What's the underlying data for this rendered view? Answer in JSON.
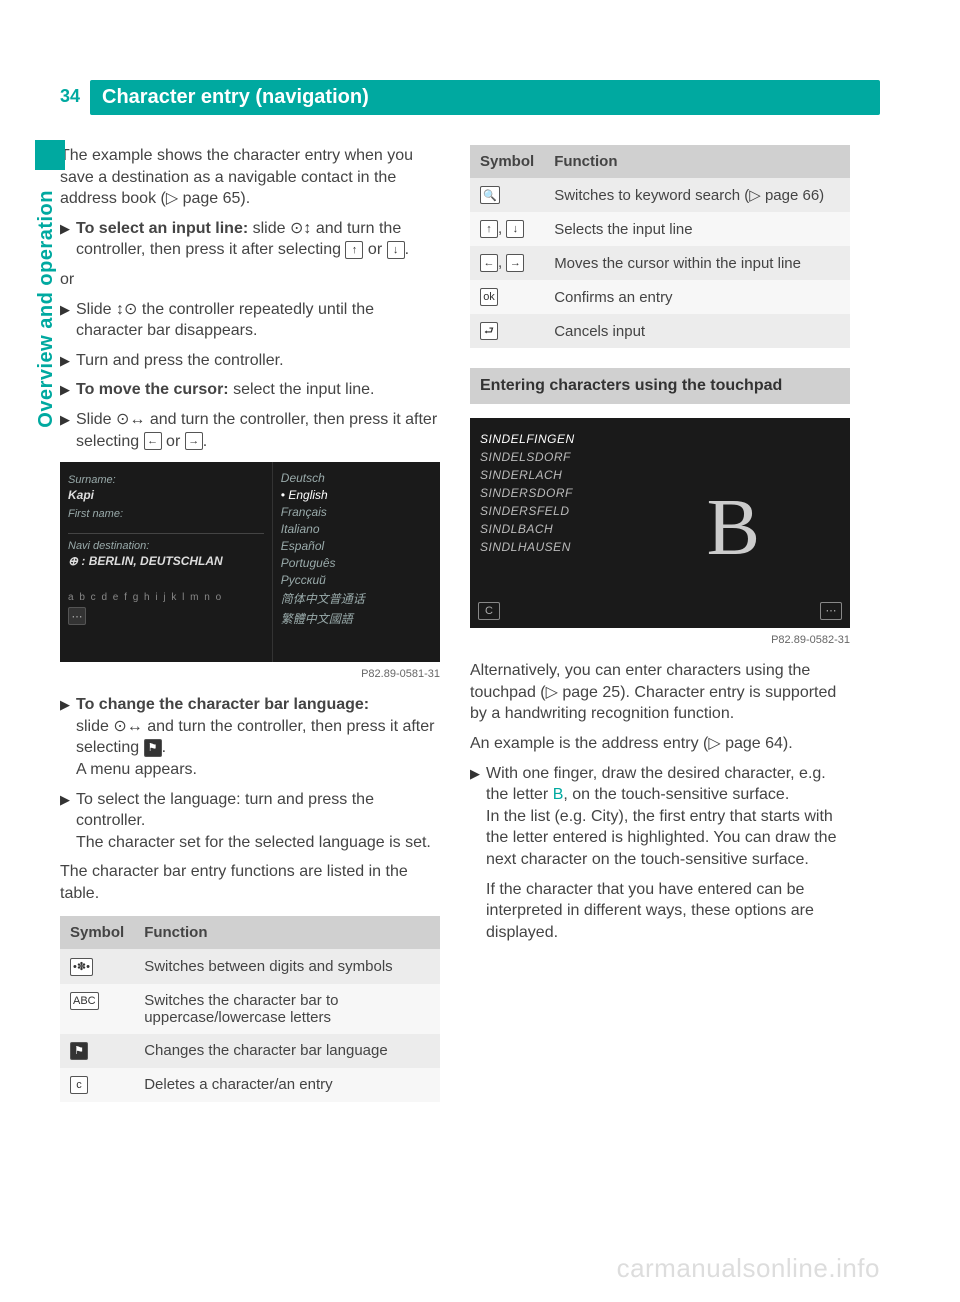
{
  "page_number": "34",
  "title": "Character entry (navigation)",
  "side_tab": "Overview and operation",
  "left": {
    "intro": "The example shows the character entry when you save a destination as a navigable contact in the address book (▷ page 65).",
    "step1_label": "To select an input line:",
    "step1_rest": " slide ⊙↕ and turn the controller, then press it after selecting ",
    "step1_or_text": " or ",
    "step1_end": ".",
    "or": "or",
    "step2": "Slide ↕⊙ the controller repeatedly until the character bar disappears.",
    "step3": "Turn and press the controller.",
    "step4_label": "To move the cursor:",
    "step4_rest": " select the input line.",
    "step5": "Slide ⊙↔ and turn the controller, then press it after selecting ",
    "step5_or": " or ",
    "step5_end": ".",
    "shot1": {
      "surname_label": "Surname:",
      "surname_val": "Kapi",
      "firstname_label": "First name:",
      "navi_label": "Navi destination:",
      "navi_val": "⊕ : BERLIN, DEUTSCHLAN",
      "charbar": "a b c d e f g h i j k l m n o",
      "langs": [
        "Deutsch",
        "English",
        "Français",
        "Italiano",
        "Español",
        "Português",
        "Русский",
        "简体中文普通话",
        "繁體中文國語"
      ],
      "caption": "P82.89-0581-31"
    },
    "step6_label": "To change the character bar language:",
    "step6_rest": "slide ⊙↔ and turn the controller, then press it after selecting ",
    "step6_end": ".",
    "step6_result": "A menu appears.",
    "step7": "To select the language: turn and press the controller.",
    "step7_result": "The character set for the selected language is set.",
    "table_intro": "The character bar entry functions are listed in the table.",
    "table_headers": {
      "symbol": "Symbol",
      "function": "Function"
    },
    "table_rows": [
      {
        "symbol": "*$%",
        "func": "Switches between digits and symbols"
      },
      {
        "symbol": "ABC",
        "func": "Switches the character bar to uppercase/lowercase letters"
      },
      {
        "symbol": "flag",
        "func": "Changes the character bar language"
      },
      {
        "symbol": "c",
        "func": "Deletes a character/an entry"
      }
    ]
  },
  "right": {
    "table_headers": {
      "symbol": "Symbol",
      "function": "Function"
    },
    "table_rows": [
      {
        "symbol": "search",
        "func": "Switches to keyword search (▷ page 66)"
      },
      {
        "symbol": "up,down",
        "func": "Selects the input line"
      },
      {
        "symbol": "left,right",
        "func": "Moves the cursor within the input line"
      },
      {
        "symbol": "ok",
        "func": "Confirms an entry"
      },
      {
        "symbol": "back",
        "func": "Cancels input"
      }
    ],
    "section_title": "Entering characters using the touchpad",
    "shot2": {
      "list": [
        "SINDELFINGEN",
        "SINDELSDORF",
        "SINDERLACH",
        "SINDERSDORF",
        "SINDERSFELD",
        "SINDLBACH",
        "SINDLHAUSEN"
      ],
      "letter": "B",
      "caption": "P82.89-0582-31"
    },
    "para1": "Alternatively, you can enter characters using the touchpad (▷ page 25). Character entry is supported by a handwriting recognition function.",
    "para2": "An example is the address entry (▷ page 64).",
    "step1a": "With one finger, draw the desired character, e.g. the letter ",
    "step1_letter": "B",
    "step1b": ", on the touch-sensitive surface.",
    "step1_result": "In the list (e.g. City), the first entry that starts with the letter entered is highlighted. You can draw the next character on the touch-sensitive surface.",
    "step1_note": "If the character that you have entered can be interpreted in different ways, these options are displayed."
  },
  "watermark": "carmanualsonline.info"
}
